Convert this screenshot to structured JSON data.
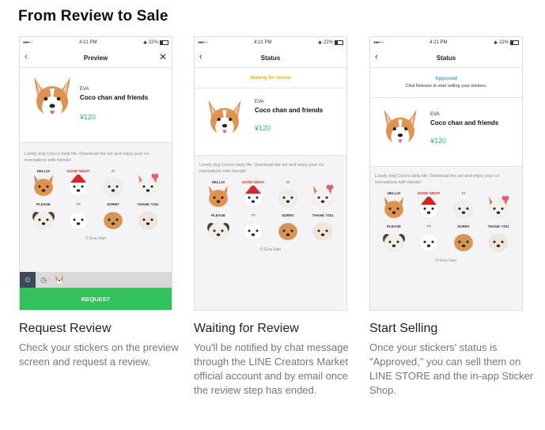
{
  "page_title": "From Review to Sale",
  "status_bar": {
    "dots": "●●●○○",
    "time": "4:21 PM",
    "bluetooth": "✱",
    "battery": "22%"
  },
  "product": {
    "creator": "EVA",
    "name": "Coco chan and friends",
    "price": "¥120"
  },
  "description": "Lovely dog Coco's daily life. Download the set and enjoy your co-nversations with friends!",
  "author_credit": "© Eva Han",
  "sticker_texts": [
    "HELLO!",
    "GOOD NIGHT",
    "!!!",
    "",
    "PLEASE",
    "??",
    "SORRY",
    "THANK YOU"
  ],
  "colors": {
    "accent_green": "#33c25a",
    "price_green": "#2cc05f",
    "waiting_yellow": "#e8b400",
    "approved_blue": "#4aa0e0"
  },
  "cards": [
    {
      "nav_title": "Preview",
      "button_label": "REQUEST",
      "tab_icons": [
        "emoji-icon",
        "clock-icon",
        "dog-sticker-icon"
      ],
      "title": "Request Review",
      "description": "Check your stickers on the preview screen and request a review."
    },
    {
      "nav_title": "Status",
      "status_text": "Waiting for review",
      "title": "Waiting for Review",
      "description": "You'll be notified by chat message through the LINE Creators Market official account and by email once the review step has ended."
    },
    {
      "nav_title": "Status",
      "status_text": "Approved",
      "status_subtext": "Click Release to start selling your stickers.",
      "title": "Start Selling",
      "description": "Once your stickers' status is \"Approved,\" you can sell them on LINE STORE and the in-app Sticker Shop."
    }
  ]
}
